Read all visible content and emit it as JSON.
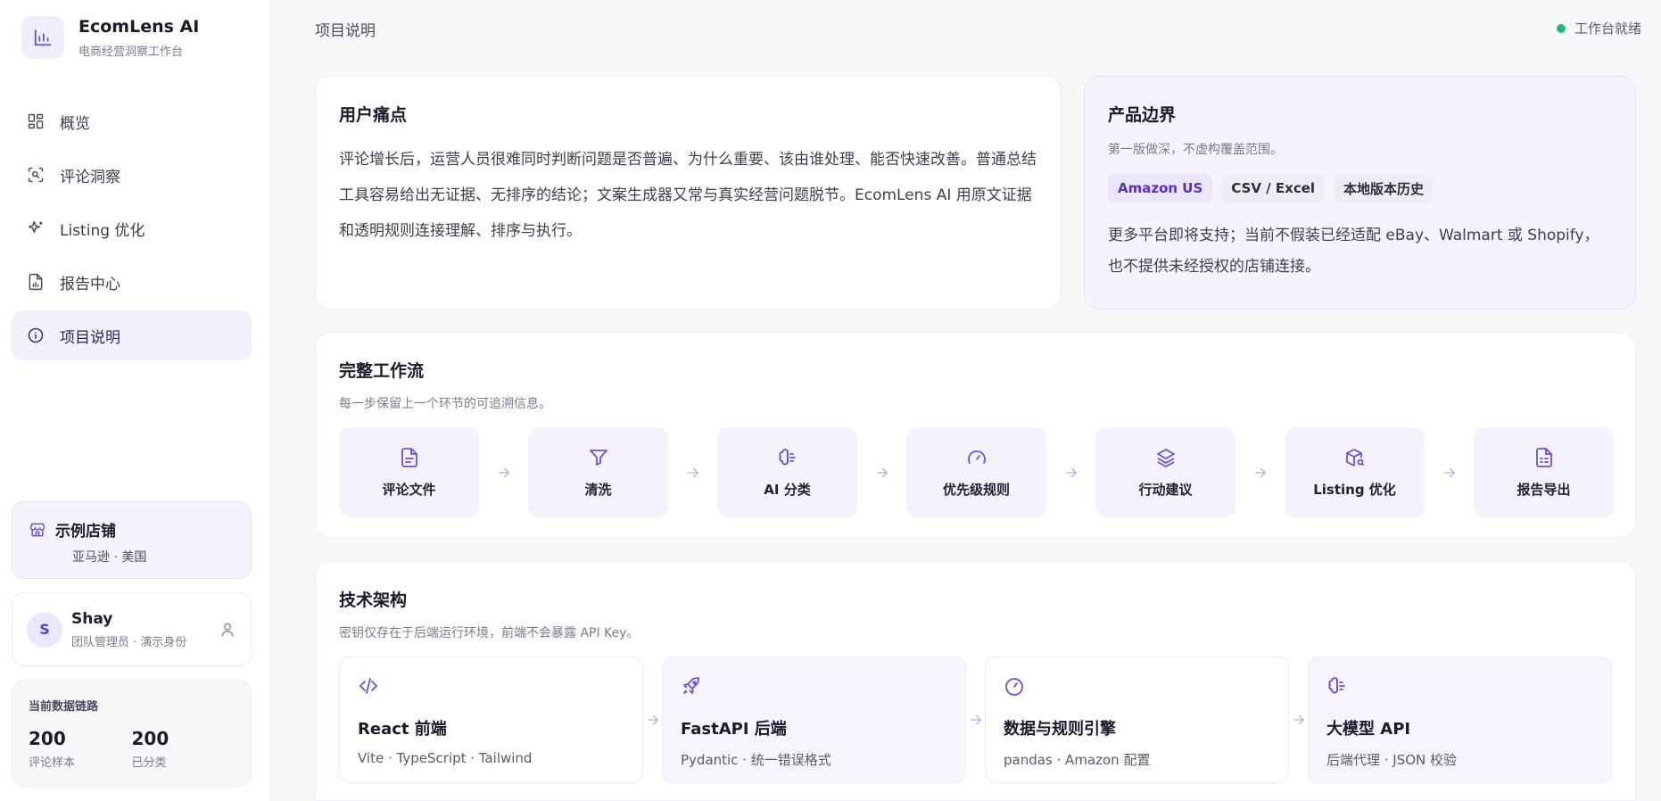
{
  "brand": {
    "name": "EcomLens AI",
    "subtitle": "电商经营洞察工作台"
  },
  "nav": {
    "items": [
      {
        "label": "概览",
        "icon": "dashboard-icon"
      },
      {
        "label": "评论洞察",
        "icon": "scan-search-icon"
      },
      {
        "label": "Listing 优化",
        "icon": "sparkle-icon"
      },
      {
        "label": "报告中心",
        "icon": "report-chart-icon"
      },
      {
        "label": "项目说明",
        "icon": "info-icon",
        "active": true
      }
    ]
  },
  "store": {
    "name": "示例店铺",
    "meta": "亚马逊 · 美国"
  },
  "user": {
    "initial": "S",
    "name": "Shay",
    "role": "团队管理员 · 演示身份"
  },
  "chain": {
    "title": "当前数据链路",
    "stats": [
      {
        "value": "200",
        "label": "评论样本"
      },
      {
        "value": "200",
        "label": "已分类"
      }
    ]
  },
  "topbar": {
    "title": "项目说明",
    "status": "工作台就绪",
    "status_color": "#22b573"
  },
  "pain": {
    "title": "用户痛点",
    "body": "评论增长后，运营人员很难同时判断问题是否普遍、为什么重要、该由谁处理、能否快速改善。普通总结工具容易给出无证据、无排序的结论；文案生成器又常与真实经营问题脱节。EcomLens AI 用原文证据和透明规则连接理解、排序与执行。"
  },
  "scope": {
    "title": "产品边界",
    "subtitle": "第一版做深，不虚构覆盖范围。",
    "tags": [
      "Amazon US",
      "CSV / Excel",
      "本地版本历史"
    ],
    "body": "更多平台即将支持；当前不假装已经适配 eBay、Walmart 或 Shopify，也不提供未经授权的店铺连接。"
  },
  "workflow": {
    "title": "完整工作流",
    "subtitle": "每一步保留上一个环节的可追溯信息。",
    "steps": [
      {
        "label": "评论文件",
        "icon": "file-text-icon"
      },
      {
        "label": "清洗",
        "icon": "filter-icon"
      },
      {
        "label": "AI 分类",
        "icon": "brain-icon"
      },
      {
        "label": "优先级规则",
        "icon": "gauge-icon"
      },
      {
        "label": "行动建议",
        "icon": "layers-icon"
      },
      {
        "label": "Listing 优化",
        "icon": "package-search-icon"
      },
      {
        "label": "报告导出",
        "icon": "file-export-icon"
      }
    ]
  },
  "architecture": {
    "title": "技术架构",
    "subtitle": "密钥仅存在于后端运行环境，前端不会暴露 API Key。",
    "layers": [
      {
        "name": "React 前端",
        "desc": "Vite · TypeScript · Tailwind",
        "icon": "code-icon"
      },
      {
        "name": "FastAPI 后端",
        "desc": "Pydantic · 统一错误格式",
        "icon": "rocket-icon"
      },
      {
        "name": "数据与规则引擎",
        "desc": "pandas · Amazon 配置",
        "icon": "gauge-icon"
      },
      {
        "name": "大模型 API",
        "desc": "后端代理 · JSON 校验",
        "icon": "brain-icon"
      }
    ]
  },
  "colors": {
    "accent": "#6d4fd8",
    "accent_soft": "#f3f0fd"
  }
}
